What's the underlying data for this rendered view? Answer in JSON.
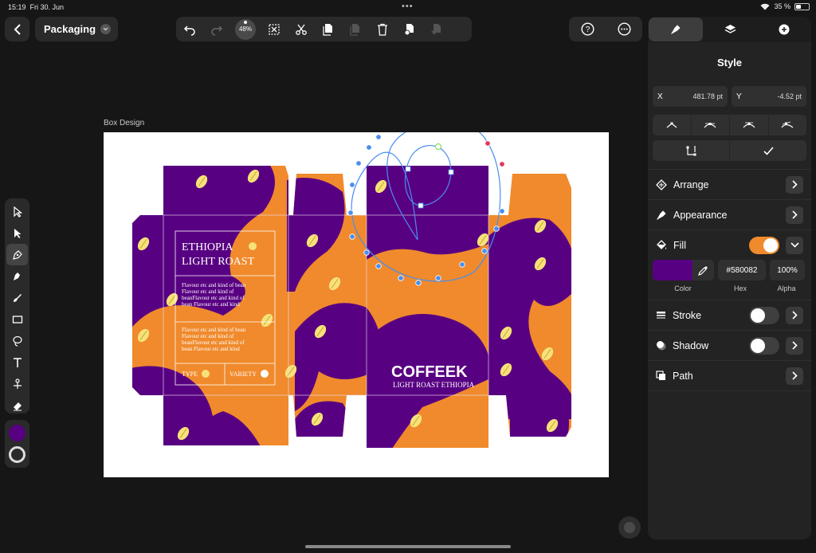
{
  "status": {
    "time": "15:19",
    "date": "Fri 30. Jun",
    "battery": "35 %"
  },
  "document": {
    "name": "Packaging",
    "zoom": "48%"
  },
  "artboard": {
    "label": "Box Design"
  },
  "design": {
    "title_line1": "ETHIOPIA",
    "title_line2": "LIGHT ROAST",
    "body1": [
      "Flavour etc and kind of bean",
      "Flavour etc and kind of",
      "beanFlavour etc and kind of",
      "bean Flavour etc and kind"
    ],
    "body2": [
      "Flavour etc and kind of bean",
      "Flavour etc and kind of",
      "beanFlavour etc and kind of",
      "bean Flavour etc and kind"
    ],
    "type_label": "TYPE",
    "variety_label": "VARIETY",
    "brand": "COFFEEK",
    "brand_sub": "LIGHT ROAST ETHIOPIA"
  },
  "panel": {
    "title": "Style",
    "x_label": "X",
    "x_value": "481.78 pt",
    "y_label": "Y",
    "y_value": "-4.52 pt",
    "arrange": "Arrange",
    "appearance": "Appearance",
    "fill": "Fill",
    "fill_hex": "#580082",
    "fill_alpha": "100%",
    "color_caption": "Color",
    "hex_caption": "Hex",
    "alpha_caption": "Alpha",
    "stroke": "Stroke",
    "shadow": "Shadow",
    "path": "Path"
  },
  "colors": {
    "purple": "#580082",
    "orange": "#f08a2c",
    "bean": "#f7e27a",
    "accent": "#f08a2c"
  }
}
